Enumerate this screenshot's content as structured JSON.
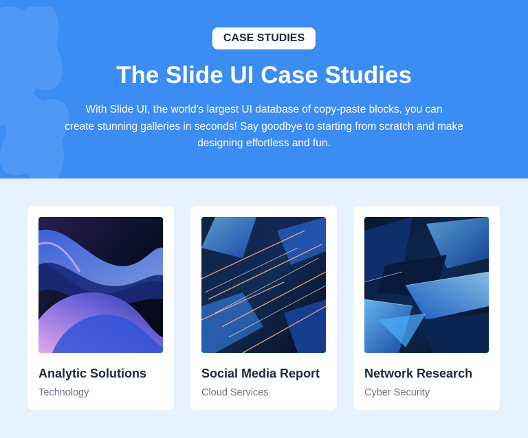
{
  "hero": {
    "badge": "CASE STUDIES",
    "title": "The Slide UI Case Studies",
    "description_lines": [
      "With Slide UI, the world's largest UI database of copy-paste blocks, you can",
      "create stunning galleries in seconds! Say goodbye to starting from scratch and make",
      "designing effortless and fun."
    ],
    "background_color": "#3b8cf3"
  },
  "cards": [
    {
      "title": "Analytic Solutions",
      "category": "Technology"
    },
    {
      "title": "Social Media Report",
      "category": "Cloud Services"
    },
    {
      "title": "Network Research",
      "category": "Cyber Security"
    }
  ],
  "colors": {
    "page_background": "#e6f2fe",
    "card_background": "#ffffff",
    "title_text": "#1f2937",
    "subtitle_text": "#6b7280"
  }
}
